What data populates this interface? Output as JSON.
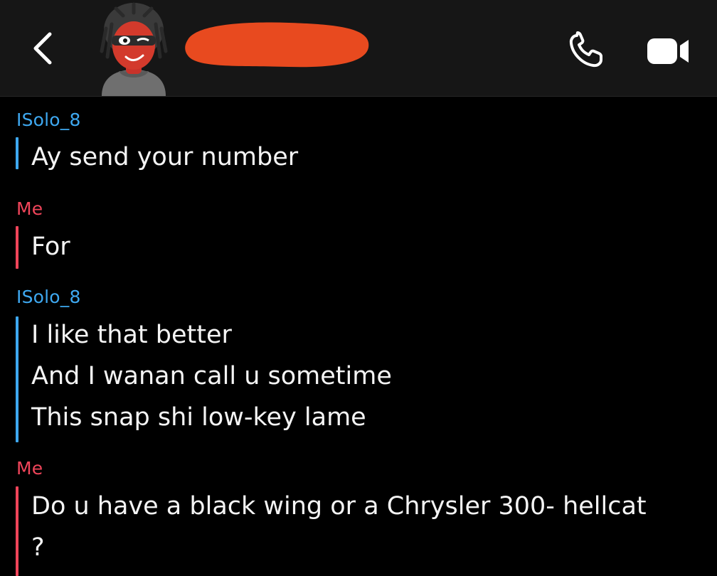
{
  "header": {
    "back_icon": "chevron-left-icon",
    "call_icon": "phone-icon",
    "video_icon": "video-camera-icon",
    "colors": {
      "background": "#161616",
      "icon": "#ffffff",
      "redaction": "#e84a1f"
    }
  },
  "colors": {
    "them": "#3ea8f0",
    "me": "#f0455a",
    "text": "#f4f4f4",
    "background": "#000000"
  },
  "messages": [
    {
      "sender": "ISolo_8",
      "lines": [
        "Ay send your number"
      ]
    },
    {
      "sender": "Me",
      "lines": [
        "For"
      ]
    },
    {
      "sender": "ISolo_8",
      "lines": [
        "I like that better",
        "And I wanan call u sometime",
        "This snap shi low-key lame"
      ]
    },
    {
      "sender": "Me",
      "lines": [
        "Do u have a black wing or a Chrysler 300- hellcat",
        "?"
      ]
    }
  ]
}
